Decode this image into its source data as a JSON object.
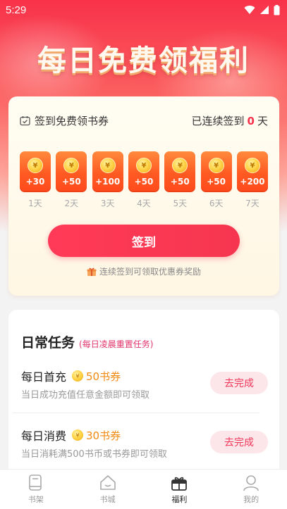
{
  "status": {
    "time": "5:29"
  },
  "hero": {
    "title": "每日免费领福利"
  },
  "signin": {
    "title": "签到免费领书券",
    "streak_prefix": "已连续签到",
    "streak_count": "0",
    "streak_suffix": "天",
    "days": [
      {
        "reward": "+30",
        "label": "1天"
      },
      {
        "reward": "+50",
        "label": "2天"
      },
      {
        "reward": "+100",
        "label": "3天"
      },
      {
        "reward": "+50",
        "label": "4天"
      },
      {
        "reward": "+50",
        "label": "5天"
      },
      {
        "reward": "+50",
        "label": "6天"
      },
      {
        "reward": "+200",
        "label": "7天"
      }
    ],
    "coin_symbol": "¥",
    "button_label": "签到",
    "hint": "连续签到可领取优惠券奖励"
  },
  "tasks": {
    "title": "日常任务",
    "subtitle": "(每日凌晨重置任务)",
    "items": [
      {
        "name": "每日首充",
        "reward": "50书券",
        "desc": "当日成功充值任意金额即可领取",
        "action": "去完成"
      },
      {
        "name": "每日消费",
        "reward": "30书券",
        "desc": "当日消耗满500书币或书券即可领取",
        "action": "去完成"
      }
    ]
  },
  "tabbar": {
    "items": [
      {
        "label": "书架",
        "icon": "book-icon"
      },
      {
        "label": "书城",
        "icon": "store-icon"
      },
      {
        "label": "福利",
        "icon": "gift-icon"
      },
      {
        "label": "我的",
        "icon": "profile-icon"
      }
    ],
    "active": "福利"
  },
  "colors": {
    "accent": "#f5334d",
    "reward_orange": "#f08a12",
    "tile_orange": "#ff5a22"
  }
}
